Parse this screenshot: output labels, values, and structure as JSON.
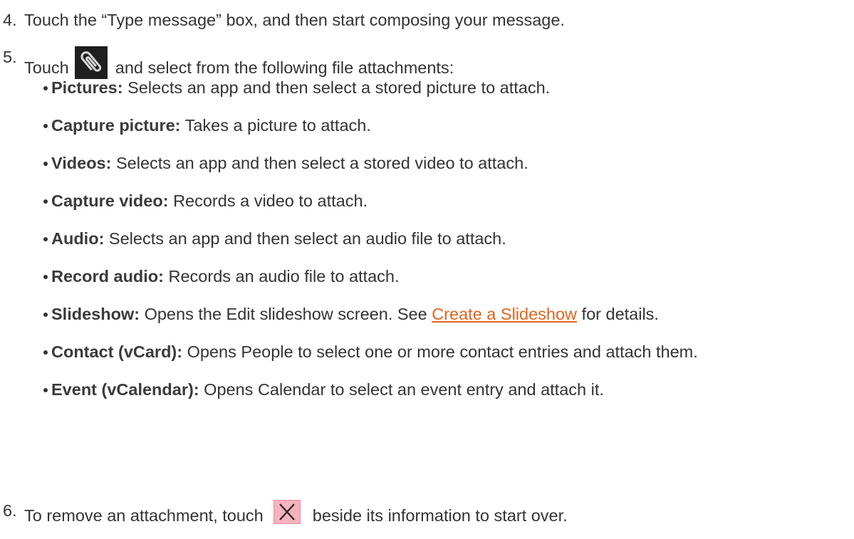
{
  "steps": {
    "step4": {
      "number": "4.",
      "text": "Touch the “Type message” box, and then start composing your message."
    },
    "step5": {
      "number": "5.",
      "prefix": "Touch",
      "suffix": "and select from the following file attachments:",
      "icon": "paperclip-icon"
    },
    "step6": {
      "number": "6.",
      "prefix": "To remove an attachment, touch",
      "suffix": "beside its information to start over.",
      "icon": "remove-x-icon"
    }
  },
  "attachments": [
    {
      "term": "Pictures:",
      "desc": "Selects an app and then select a stored picture to attach."
    },
    {
      "term": "Capture picture:",
      "desc": "Takes a picture to attach."
    },
    {
      "term": "Videos:",
      "desc": "Selects an app and then select a stored video to attach."
    },
    {
      "term": "Capture video:",
      "desc": "Records a video to attach."
    },
    {
      "term": "Audio:",
      "desc": "Selects an app and then select an audio file to attach."
    },
    {
      "term": "Record audio:",
      "desc": "Records an audio file to attach."
    },
    {
      "term": "Slideshow:",
      "desc_before": "Opens the Edit slideshow screen. See",
      "link": "Create a Slideshow",
      "desc_after": "for details."
    },
    {
      "term": "Contact (vCard):",
      "desc": "Opens People to select one or more contact entries and attach them."
    },
    {
      "term": "Event (vCalendar):",
      "desc": "Opens Calendar to select an event entry and attach it."
    }
  ],
  "colors": {
    "text": "#333333",
    "link": "#e0641c",
    "remove_icon_bg": "#f7b3bd",
    "clip_icon_bg": "#1f1f1f"
  }
}
